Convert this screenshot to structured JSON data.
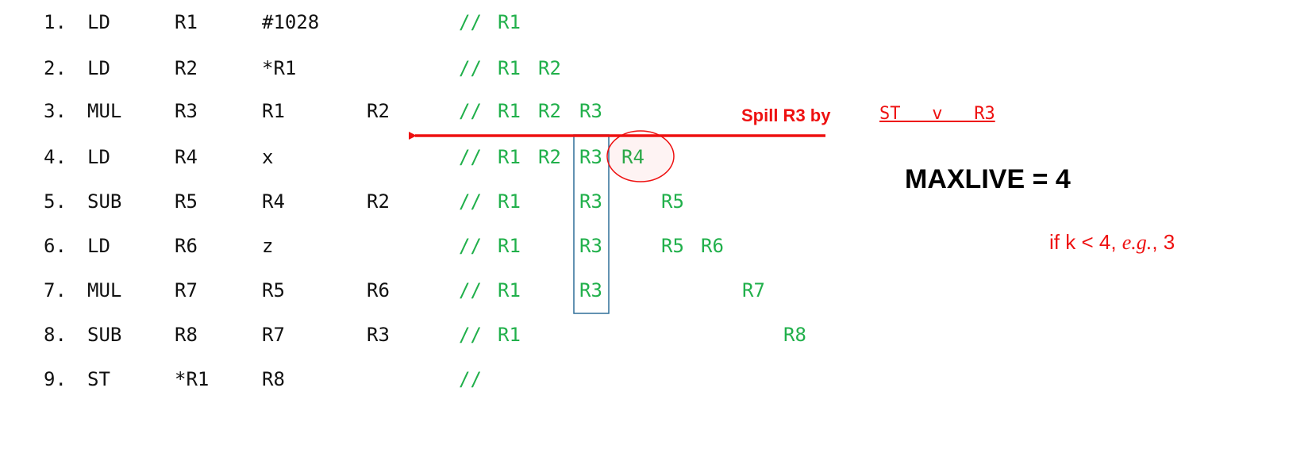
{
  "instructions": [
    {
      "num": "1.",
      "op": "LD",
      "a": "R1",
      "b": "#1028",
      "c": "",
      "comment": "//",
      "live": [
        "R1"
      ]
    },
    {
      "num": "2.",
      "op": "LD",
      "a": "R2",
      "b": "*R1",
      "c": "",
      "comment": "//",
      "live": [
        "R1",
        "R2"
      ]
    },
    {
      "num": "3.",
      "op": "MUL",
      "a": "R3",
      "b": "R1",
      "c": "R2",
      "comment": "//",
      "live": [
        "R1",
        "R2",
        "R3"
      ]
    },
    {
      "num": "4.",
      "op": "LD",
      "a": "R4",
      "b": "x",
      "c": "",
      "comment": "//",
      "live": [
        "R1",
        "R2",
        "R3",
        "R4"
      ]
    },
    {
      "num": "5.",
      "op": "SUB",
      "a": "R5",
      "b": "R4",
      "c": "R2",
      "comment": "//",
      "live": [
        "R1",
        "R3",
        "R5"
      ]
    },
    {
      "num": "6.",
      "op": "LD",
      "a": "R6",
      "b": "z",
      "c": "",
      "comment": "//",
      "live": [
        "R1",
        "R3",
        "R5",
        "R6"
      ]
    },
    {
      "num": "7.",
      "op": "MUL",
      "a": "R7",
      "b": "R5",
      "c": "R6",
      "comment": "//",
      "live": [
        "R1",
        "R3",
        "R7"
      ]
    },
    {
      "num": "8.",
      "op": "SUB",
      "a": "R8",
      "b": "R7",
      "c": "R3",
      "comment": "//",
      "live": [
        "R1",
        "R8"
      ]
    },
    {
      "num": "9.",
      "op": "ST",
      "a": "*R1",
      "b": "R8",
      "c": "",
      "comment": "//",
      "live": []
    }
  ],
  "spill": {
    "label": "Spill R3 by",
    "instr": "ST   v   R3"
  },
  "maxlive": "MAXLIVE = 4",
  "condition": {
    "prefix": "if k < 4, ",
    "eg": "e.g.",
    "suffix": ", 3"
  },
  "colors": {
    "code": "#111111",
    "live": "#21b04b",
    "accent": "#ee1111",
    "box": "#2f6f99"
  }
}
